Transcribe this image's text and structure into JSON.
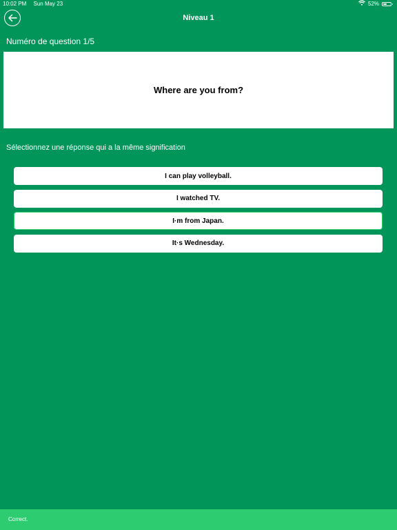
{
  "status_bar": {
    "time": "10:02 PM",
    "date": "Sun May 23",
    "battery_text": "52%",
    "battery_level": 0.52,
    "wifi_icon": "wifi-icon",
    "battery_icon": "battery-icon"
  },
  "nav": {
    "title": "Niveau 1",
    "back_icon": "arrow-left-circle-icon"
  },
  "question": {
    "number_label": "Numéro de question 1/5",
    "text": "Where are you from?"
  },
  "instruction": "Sélectionnez une réponse qui a la même signification",
  "answers": [
    {
      "label": "I can play volleyball."
    },
    {
      "label": "I watched TV."
    },
    {
      "label": "I·m from Japan."
    },
    {
      "label": "It·s Wednesday."
    }
  ],
  "selected_answer_index": 2,
  "toast": {
    "message": "Correct."
  },
  "colors": {
    "background": "#02955a",
    "toast": "#2ecc71",
    "selected_border": "#35d170",
    "card": "#ffffff"
  }
}
